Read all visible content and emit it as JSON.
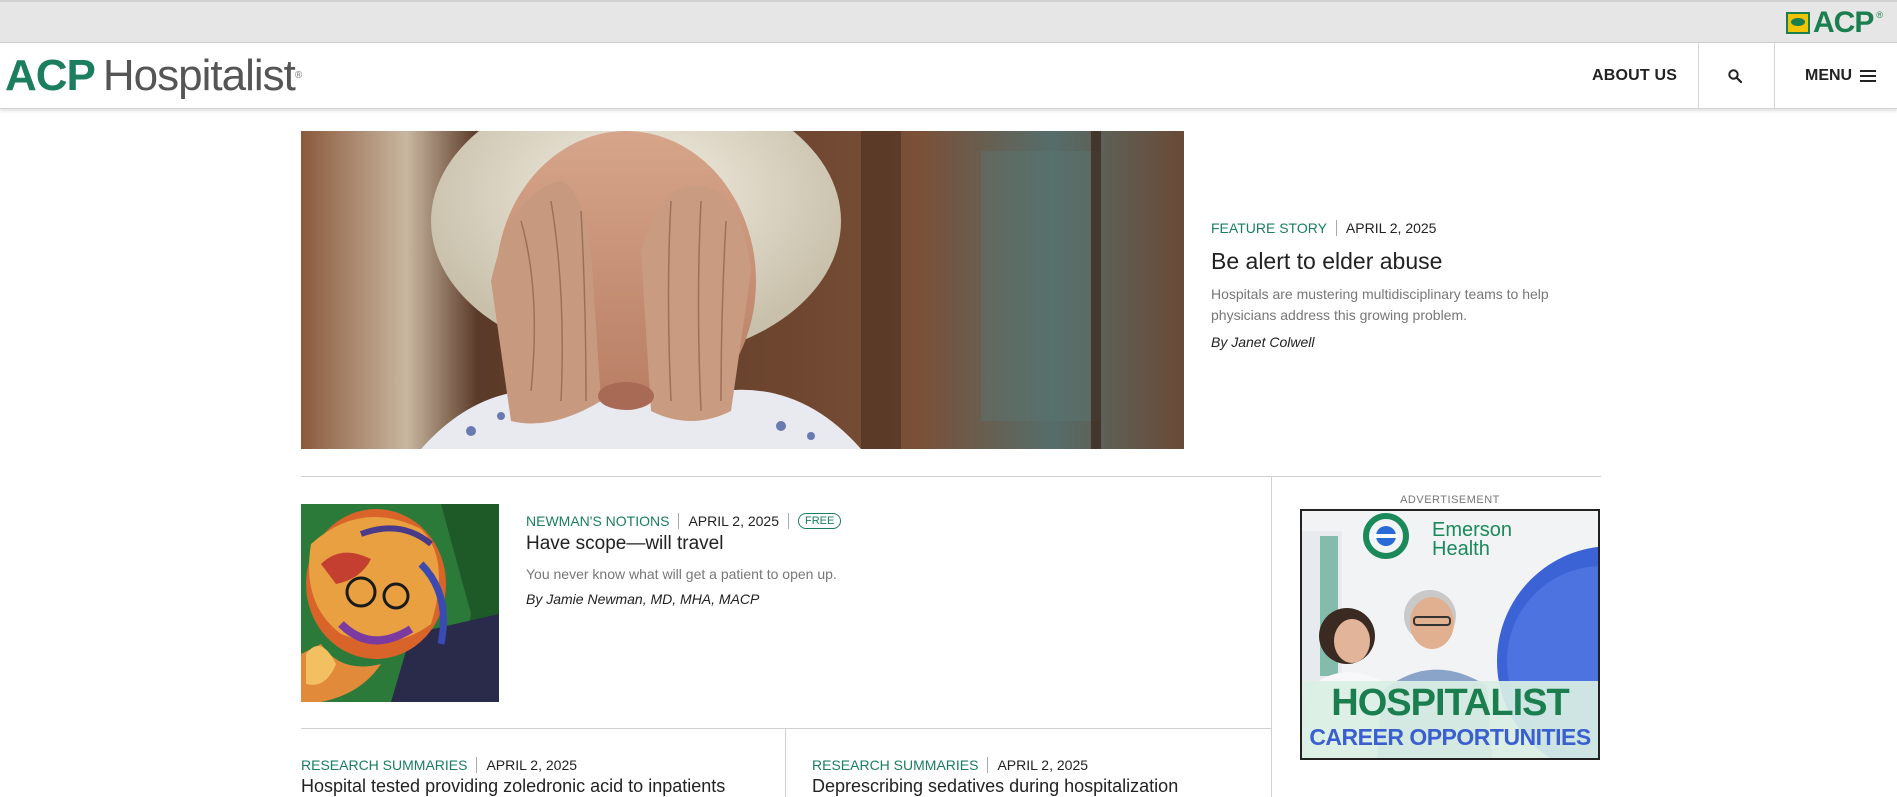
{
  "header": {
    "brand_acp": "ACP",
    "brand_hospitalist": "Hospitalist",
    "brand_mark": "®",
    "about_label": "ABOUT US",
    "search_icon": "search-icon",
    "menu_label": "MENU",
    "top_logo_text": "ACP",
    "top_logo_reg": "®"
  },
  "hero": {
    "category": "FEATURE STORY",
    "date": "APRIL 2, 2025",
    "title": "Be alert to elder abuse",
    "dek": "Hospitals are mustering multidisciplinary teams to help physicians address this growing problem.",
    "byline": "By Janet Colwell"
  },
  "article2": {
    "category": "NEWMAN'S NOTIONS",
    "date": "APRIL 2, 2025",
    "badge": "FREE",
    "title": "Have scope—will travel",
    "dek": "You never know what will get a patient to open up.",
    "byline": "By Jamie Newman, MD, MHA, MACP"
  },
  "ad": {
    "label": "ADVERTISEMENT",
    "brand_line1": "Emerson",
    "brand_line2": "Health",
    "headline": "HOSPITALIST",
    "subhead": "CAREER OPPORTUNITIES"
  },
  "research": [
    {
      "category": "RESEARCH SUMMARIES",
      "date": "APRIL 2, 2025",
      "title": "Hospital tested providing zoledronic acid to inpatients"
    },
    {
      "category": "RESEARCH SUMMARIES",
      "date": "APRIL 2, 2025",
      "title": "Deprescribing sedatives during hospitalization"
    }
  ],
  "colors": {
    "brand_green": "#1a7e5f",
    "acp_yellow": "#f0c400",
    "ad_blue": "#3a5fcf"
  }
}
